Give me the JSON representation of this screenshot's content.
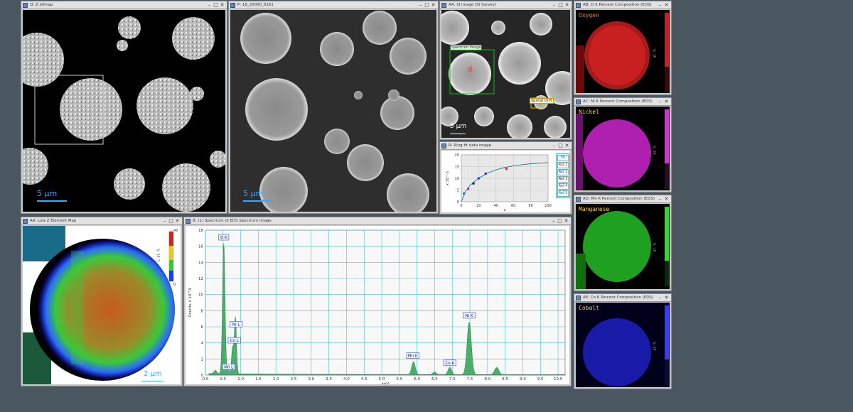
{
  "windows": {
    "qmap": {
      "title": "Q: Z elfmap",
      "scale": "5 µm"
    },
    "haadf": {
      "title": "P: 18_20000_0161",
      "scale": "5 µm"
    },
    "survey": {
      "title": "AA: SI image (SI Survey)",
      "scale": "5 µm",
      "si_label": "Spectrum Image",
      "drift_label": "Spatial Drift",
      "marker": "1"
    },
    "fit": {
      "title": "R: Ring fit data image",
      "legend": [
        "Fit",
        "Ref 1",
        "Ref 2",
        "Ref 3",
        "Ref 4",
        "Ref 5"
      ],
      "legend_colors": [
        "#0a6a8a",
        "#c02a2a",
        "#1a3a9a",
        "#1a1a1a",
        "#a02aa0",
        "#1a7a9a"
      ],
      "ylabel": "x 10^-3",
      "xlabel": "z"
    },
    "lowz": {
      "title": "AA: Low Z Element Map",
      "scale": "2 µm",
      "bar_top": "45",
      "bar_bottom": "0",
      "bar_unit": "Li at. %"
    },
    "spectrum": {
      "title": "B: (1) Spectrum of EDS Spectrum Image",
      "ylabel": "Counts x 10^4",
      "xlabel": "keV"
    },
    "oxygen": {
      "title": "AB: O K Percent Composition (EDS)",
      "label": "Oxygen",
      "color": "#ff2a2a",
      "unit": "at. %"
    },
    "nickel": {
      "title": "AC: Ni K Percent Composition (EDS)",
      "label": "Nickel",
      "color": "#ff3aff",
      "unit": "at. %"
    },
    "manganese": {
      "title": "AD: Mn K Percent Composition (EDS)",
      "label": "Manganese",
      "color": "#3aff3a",
      "unit": "at. %"
    },
    "cobalt": {
      "title": "AE: Co K Percent Composition (EDS)",
      "label": "Cobalt",
      "color": "#5a5aff",
      "unit": "at. %"
    }
  },
  "chart_data": [
    {
      "type": "line",
      "x_ticks": [
        0,
        20,
        40,
        60,
        80,
        100
      ],
      "y_ticks": [
        0,
        5,
        10,
        15,
        20
      ],
      "xlim": [
        0,
        100
      ],
      "ylim": [
        0,
        20
      ],
      "xlabel": "z",
      "ylabel": "x 10^-5",
      "points": [
        [
          3,
          3.5
        ],
        [
          8,
          5.5
        ],
        [
          14,
          7.8
        ],
        [
          20,
          10
        ],
        [
          28,
          12
        ],
        [
          52,
          14
        ]
      ],
      "point_colors": [
        "#1a7a9a",
        "#a02aa0",
        "#1a1a1a",
        "#1a3a9a",
        "#1a3a9a",
        "#c02a2a"
      ],
      "curve": [
        [
          0,
          0
        ],
        [
          5,
          4.5
        ],
        [
          10,
          7
        ],
        [
          20,
          10
        ],
        [
          30,
          12.2
        ],
        [
          40,
          13.6
        ],
        [
          50,
          14.6
        ],
        [
          60,
          15.3
        ],
        [
          70,
          15.8
        ],
        [
          80,
          16.2
        ],
        [
          90,
          16.5
        ],
        [
          100,
          16.7
        ]
      ],
      "grid": true
    },
    {
      "type": "area",
      "xlabel": "keV",
      "ylabel": "Counts x 10^4",
      "xlim": [
        0,
        10.2
      ],
      "ylim": [
        0,
        18
      ],
      "x_ticks": [
        "0.0",
        "0.5",
        "1.0",
        "1.5",
        "2.0",
        "2.5",
        "3.0",
        "3.5",
        "4.0",
        "4.5",
        "5.0",
        "5.5",
        "6.0",
        "6.5",
        "7.0",
        "7.5",
        "8.0",
        "8.5",
        "9.0",
        "9.5",
        "10.0"
      ],
      "y_ticks": [
        0,
        2,
        4,
        6,
        8,
        10,
        12,
        14,
        16,
        18
      ],
      "peaks": [
        {
          "x": 0.52,
          "y": 16.2,
          "w": 0.035
        },
        {
          "x": 0.85,
          "y": 7.0,
          "w": 0.03
        },
        {
          "x": 0.77,
          "y": 3.2,
          "w": 0.03
        },
        {
          "x": 0.64,
          "y": 0.6,
          "w": 0.03
        },
        {
          "x": 0.28,
          "y": 0.4,
          "w": 0.04
        },
        {
          "x": 5.9,
          "y": 1.6,
          "w": 0.05
        },
        {
          "x": 6.5,
          "y": 0.3,
          "w": 0.05
        },
        {
          "x": 6.93,
          "y": 0.9,
          "w": 0.05
        },
        {
          "x": 7.48,
          "y": 6.5,
          "w": 0.06
        },
        {
          "x": 8.26,
          "y": 0.9,
          "w": 0.06
        }
      ],
      "labels": [
        {
          "text": "O K",
          "x": 0.52,
          "y": 16.5
        },
        {
          "text": "Ni L",
          "x": 0.87,
          "y": 5.7
        },
        {
          "text": "Co L",
          "x": 0.82,
          "y": 3.7
        },
        {
          "text": "Mn L",
          "x": 0.66,
          "y": 0.4
        },
        {
          "text": "Mn K",
          "x": 5.88,
          "y": 1.8
        },
        {
          "text": "Co K",
          "x": 6.93,
          "y": 0.9
        },
        {
          "text": "Ni K",
          "x": 7.48,
          "y": 6.8
        }
      ],
      "grid": true
    }
  ]
}
